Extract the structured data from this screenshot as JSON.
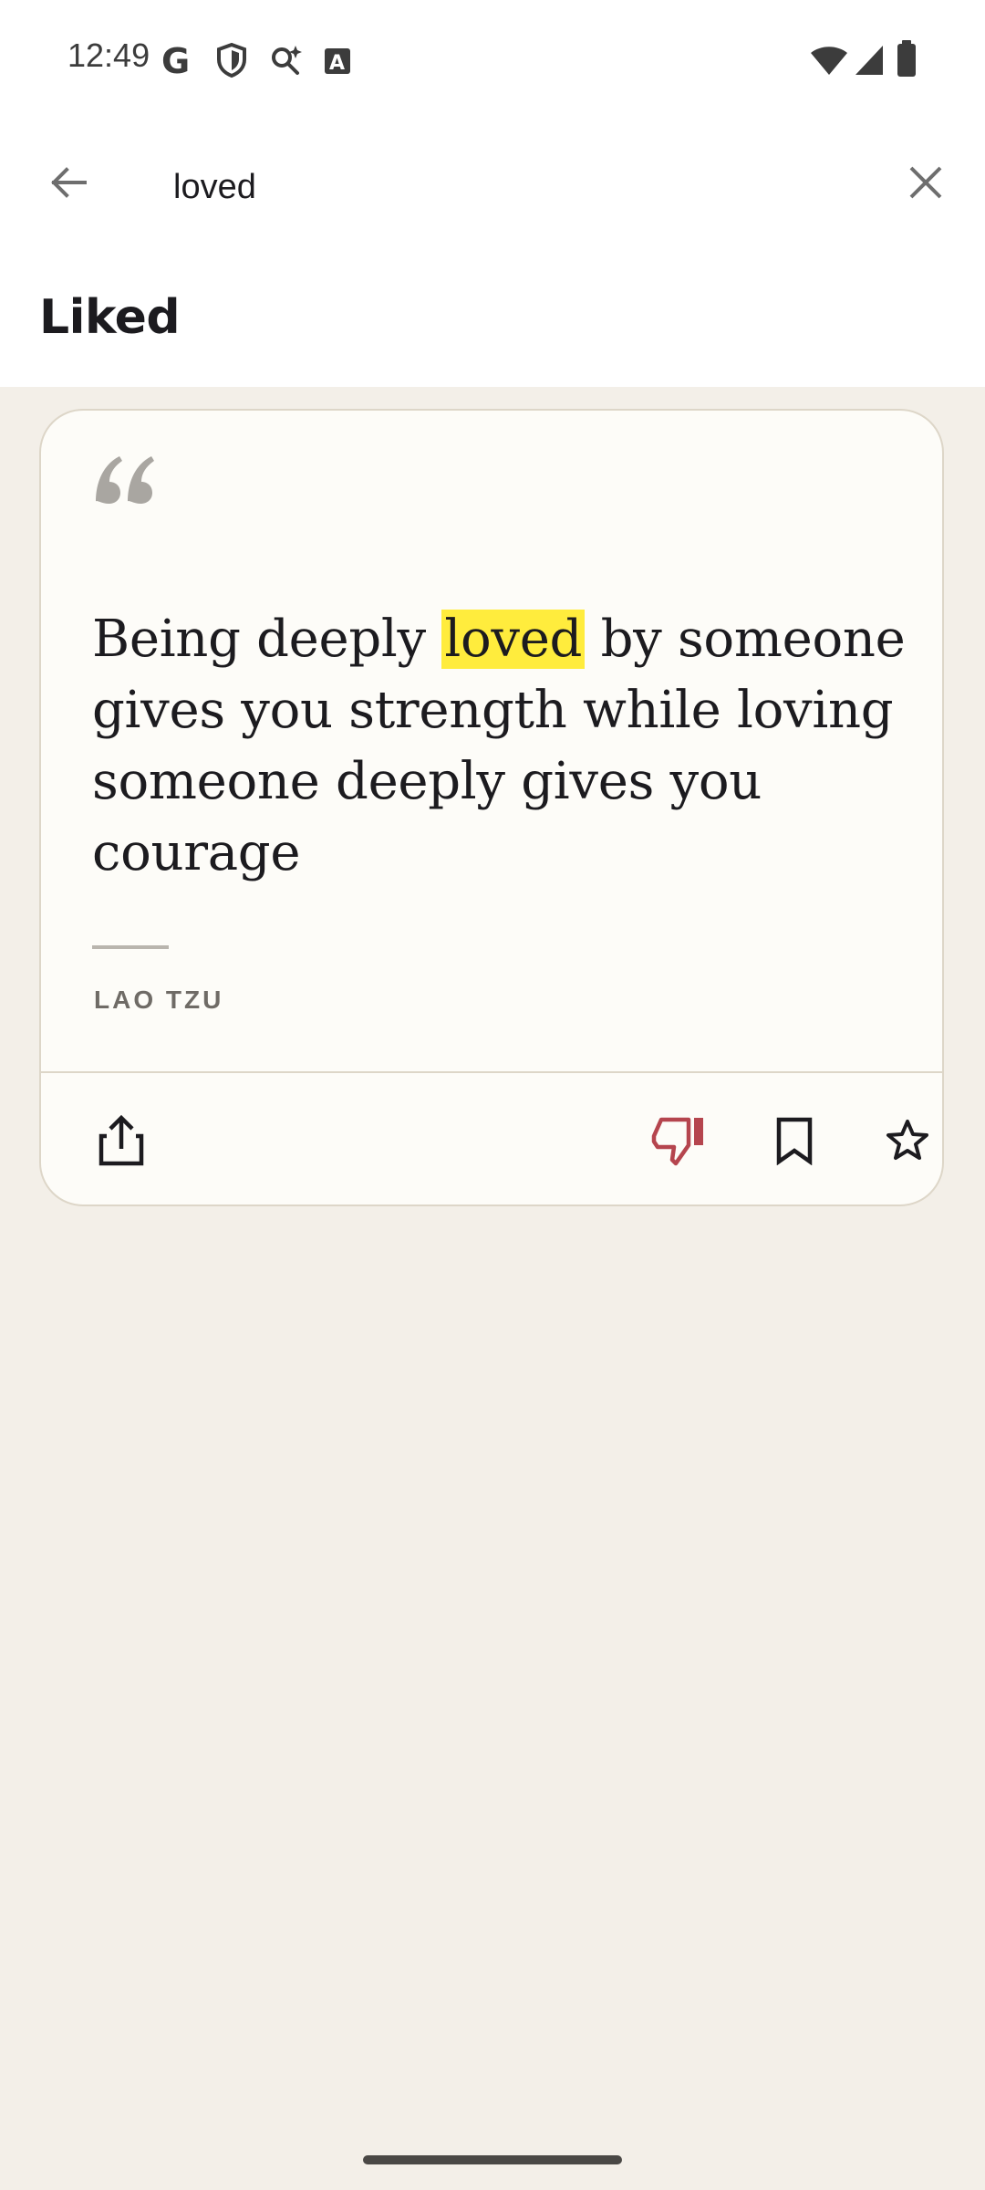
{
  "status_bar": {
    "time": "12:49",
    "left_icons": [
      "google-icon",
      "shield-icon",
      "search-sparkle-icon",
      "font-a-icon"
    ],
    "right_icons": [
      "wifi-icon",
      "signal-icon",
      "battery-icon"
    ]
  },
  "search": {
    "query": "loved",
    "back_icon": "arrow-left-icon",
    "close_icon": "close-icon"
  },
  "section": {
    "title": "Liked"
  },
  "quote_card": {
    "text_before": "Being deeply ",
    "highlight": "loved",
    "text_after": " by someone gives you strength while loving someone deeply gives you courage",
    "author": "LAO TZU",
    "actions": {
      "share_icon": "share-icon",
      "dislike_icon": "thumb-down-icon",
      "bookmark_icon": "bookmark-icon",
      "favorite_icon": "star-icon"
    }
  },
  "colors": {
    "background": "#f3efe8",
    "card_background": "#fdfcf8",
    "highlight": "#ffec3d",
    "dislike_accent": "#b5454e",
    "text": "#1c1b1f"
  }
}
